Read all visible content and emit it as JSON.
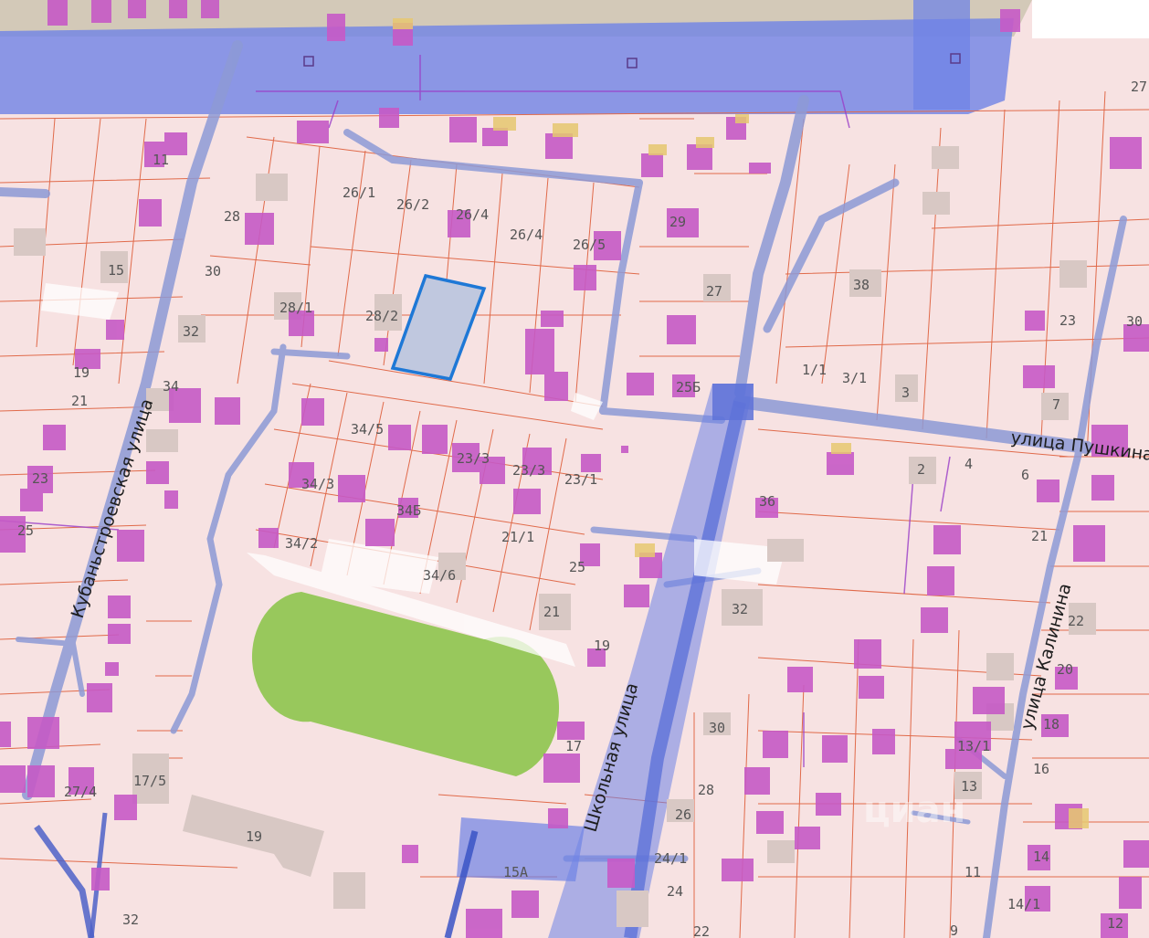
{
  "map": {
    "colors": {
      "background": "#f7e2e2",
      "parcel_border": "#e06a4a",
      "building": "#c65ac6",
      "building_gray": "#d8c8c4",
      "utility_band": "#6f83e6",
      "utility_line": "#8d9ad6",
      "selected_parcel_fill": "#c0c8df",
      "selected_parcel_border": "#1e78d6",
      "stadium": "#98c85c"
    },
    "streets": {
      "kubanstroevskaya": "Кубаньстроевская улица",
      "shkolnaya": "Школьная улица",
      "pushkina": "улица Пушкина",
      "kalinina": "улица Калинина"
    },
    "house_numbers": {
      "h26_1": "26/1",
      "h26_2": "26/2",
      "h26_4": "26/4",
      "h26_4b": "26/4",
      "h26_5": "26/5",
      "h28": "28",
      "h30a": "30",
      "h32a": "32",
      "h34a": "34",
      "h28_1": "28/1",
      "h28_2": "28/2",
      "h29": "29",
      "h27a": "27",
      "h25b": "25Б",
      "h38": "38",
      "h27b": "27",
      "h23a": "23",
      "h30b": "30",
      "h1_1": "1/1",
      "h3_1": "3/1",
      "h3": "3",
      "h7": "7",
      "h11a": "11",
      "h15a": "15",
      "h19a": "19",
      "h21a": "21",
      "h23b": "23",
      "h25a": "25",
      "h34_5": "34/5",
      "h23_3a": "23/3",
      "h23_3b": "23/3",
      "h23_1": "23/1",
      "h34_3": "34/3",
      "h34b": "34Б",
      "h34_2": "34/2",
      "h21_1": "21/1",
      "h25b2": "25",
      "h34_6": "34/6",
      "h21b": "21",
      "h19b": "19",
      "h2": "2",
      "h4": "4",
      "h6": "6",
      "h36": "36",
      "h21c": "21",
      "h22": "22",
      "h20": "20",
      "h32b": "32",
      "h30c": "30",
      "h18": "18",
      "h13_1": "13/1",
      "h16": "16",
      "h13": "13",
      "h17": "17",
      "h28b": "28",
      "h26": "26",
      "h14": "14",
      "h11b": "11",
      "h24_1": "24/1",
      "h24": "24",
      "h15a2": "15А",
      "h14_1": "14/1",
      "h9": "9",
      "h27_4": "27/4",
      "h17_5": "17/5",
      "h19c": "19",
      "h32c": "32",
      "h12": "12",
      "h22b": "22"
    },
    "watermark": "циан"
  }
}
